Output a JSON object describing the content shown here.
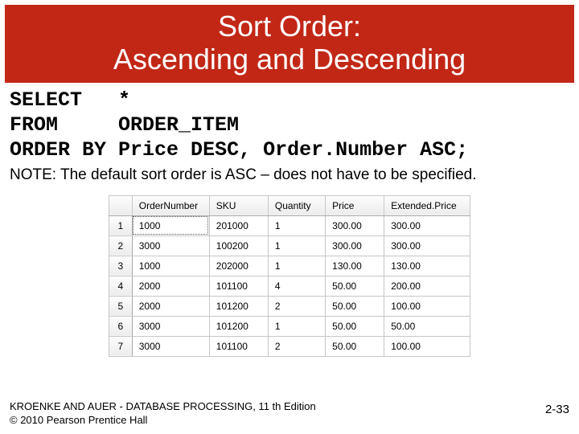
{
  "title": {
    "line1": "Sort Order:",
    "line2": "Ascending and Descending"
  },
  "sql": {
    "select_kw": "SELECT",
    "select_cols": "*",
    "from_kw": "FROM",
    "from_tbl": "ORDER_ITEM",
    "orderby_kw": "ORDER BY",
    "orderby_expr": "Price DESC, Order.Number ASC;"
  },
  "note": "NOTE: The default sort order is ASC – does not have to be specified.",
  "table": {
    "columns": [
      "OrderNumber",
      "SKU",
      "Quantity",
      "Price",
      "Extended.Price"
    ],
    "rows": [
      {
        "n": "1",
        "OrderNumber": "1000",
        "SKU": "201000",
        "Quantity": "1",
        "Price": "300.00",
        "ExtendedPrice": "300.00"
      },
      {
        "n": "2",
        "OrderNumber": "3000",
        "SKU": "100200",
        "Quantity": "1",
        "Price": "300.00",
        "ExtendedPrice": "300.00"
      },
      {
        "n": "3",
        "OrderNumber": "1000",
        "SKU": "202000",
        "Quantity": "1",
        "Price": "130.00",
        "ExtendedPrice": "130.00"
      },
      {
        "n": "4",
        "OrderNumber": "2000",
        "SKU": "101100",
        "Quantity": "4",
        "Price": "50.00",
        "ExtendedPrice": "200.00"
      },
      {
        "n": "5",
        "OrderNumber": "2000",
        "SKU": "101200",
        "Quantity": "2",
        "Price": "50.00",
        "ExtendedPrice": "100.00"
      },
      {
        "n": "6",
        "OrderNumber": "3000",
        "SKU": "101200",
        "Quantity": "1",
        "Price": "50.00",
        "ExtendedPrice": "50.00"
      },
      {
        "n": "7",
        "OrderNumber": "3000",
        "SKU": "101100",
        "Quantity": "2",
        "Price": "50.00",
        "ExtendedPrice": "100.00"
      }
    ]
  },
  "footer": {
    "line1": "KROENKE AND AUER - DATABASE PROCESSING, 11 th Edition",
    "line2": "© 2010 Pearson Prentice Hall",
    "pagenum": "2-33"
  }
}
